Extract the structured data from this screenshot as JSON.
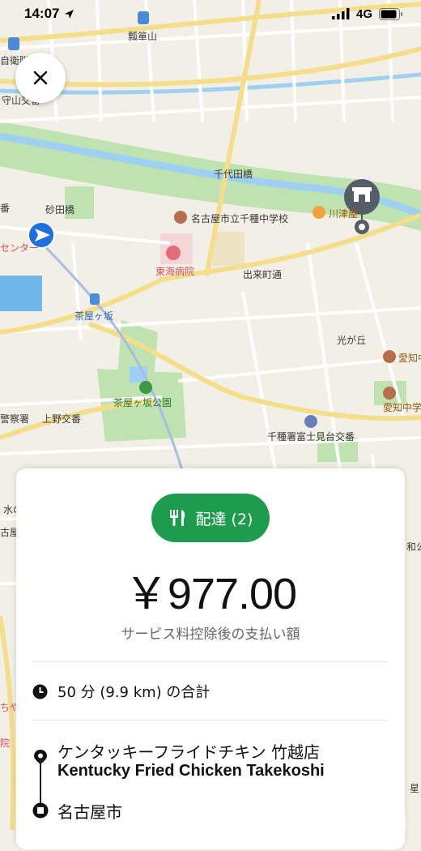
{
  "status": {
    "time": "14:07",
    "network": "4G"
  },
  "map": {
    "labels": {
      "station_north": "瓢箪山",
      "jieitai": "自衛隊",
      "moriyama": "守山交番",
      "chiyoda_bridge": "千代田橋",
      "sunada_bridge": "砂田橋",
      "school": "名古屋市立千種中学校",
      "kawazu": "川津屋",
      "tokai_hospital": "東海病院",
      "dekimachi": "出来町通",
      "chayagasaka_station": "茶屋ヶ坂",
      "hikarigaoka": "光が丘",
      "aichi": "愛知中",
      "aichi_jhs": "愛知中学",
      "park": "茶屋ヶ坂公園",
      "police_station": "警察署",
      "ueno_koban": "上野交番",
      "fujimidai_koban": "千種署富士見台交番",
      "center": "センター",
      "ban": "番",
      "mizu": "水の",
      "kosho": "古屋",
      "chiya": "ちや",
      "in": "院",
      "wako": "和公",
      "hoshi": "星"
    }
  },
  "card": {
    "pill_label": "配達 (2)",
    "price": "￥977.00",
    "subtitle": "サービス料控除後の支払い額",
    "duration": "50 分 (9.9 km) の合計",
    "pickup_name_jp": "ケンタッキーフライドチキン 竹越店",
    "pickup_name_en": "Kentucky Fried Chicken Takekoshi",
    "dropoff": "名古屋市"
  },
  "colors": {
    "accent": "#1e9c4d",
    "navigation_arrow": "#1f6fe0",
    "marker": "#555e66"
  }
}
